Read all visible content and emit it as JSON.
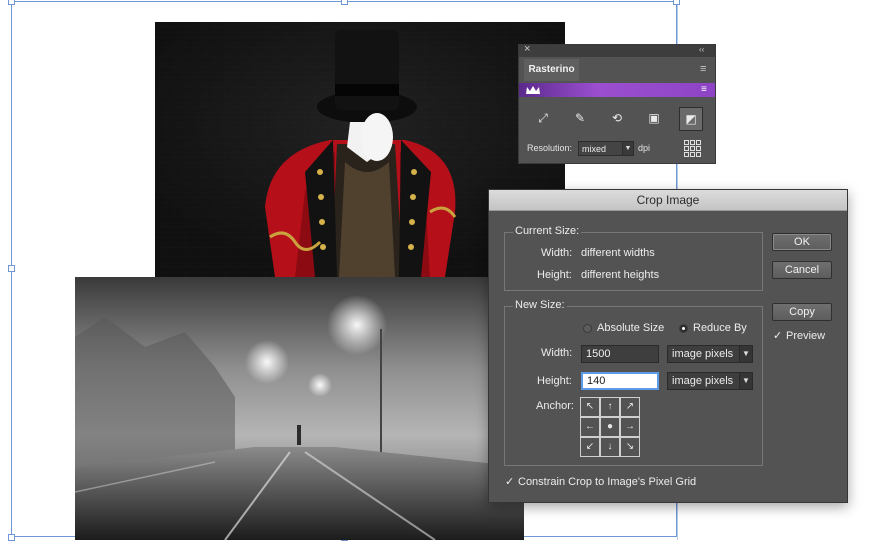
{
  "panel": {
    "title": "Rasterino",
    "close_glyph": "×",
    "collapse_glyph": "‹‹",
    "menu_glyph": "≡",
    "brand_icon": "crown-icon",
    "tools": [
      {
        "name": "expand-tool-icon",
        "glyph": "⤢"
      },
      {
        "name": "brush-tool-icon",
        "glyph": "✎"
      },
      {
        "name": "relink-tool-icon",
        "glyph": "⟲"
      },
      {
        "name": "image-tool-icon",
        "glyph": "▣"
      },
      {
        "name": "crop-tool-icon",
        "glyph": "◩"
      }
    ],
    "resolution_label": "Resolution:",
    "resolution_value": "mixed",
    "resolution_unit": "dpi"
  },
  "dialog": {
    "title": "Crop Image",
    "current_size": {
      "heading": "Current Size:",
      "width_label": "Width:",
      "width_value": "different widths",
      "height_label": "Height:",
      "height_value": "different heights"
    },
    "new_size": {
      "heading": "New Size:",
      "mode_options": [
        "Absolute Size",
        "Reduce By"
      ],
      "selected_mode": "Reduce By",
      "width_label": "Width:",
      "width_value": "1500",
      "width_unit": "image pixels",
      "height_label": "Height:",
      "height_value": "140",
      "height_unit": "image pixels",
      "anchor_label": "Anchor:",
      "anchor_glyphs": [
        "↖",
        "↑",
        "↗",
        "←",
        "●",
        "→",
        "↙",
        "↓",
        "↘"
      ]
    },
    "buttons": {
      "ok": "OK",
      "cancel": "Cancel",
      "copy": "Copy"
    },
    "preview_label": "Preview",
    "preview_checked": true,
    "constrain_label": "Constrain Crop to Image's Pixel Grid",
    "constrain_checked": true,
    "check_glyph": "✓"
  },
  "colors": {
    "panel_bg": "#535353",
    "brand_purple": "#8d44c4",
    "selection_blue": "#6f97d6",
    "focus_blue": "#5d9be8"
  }
}
